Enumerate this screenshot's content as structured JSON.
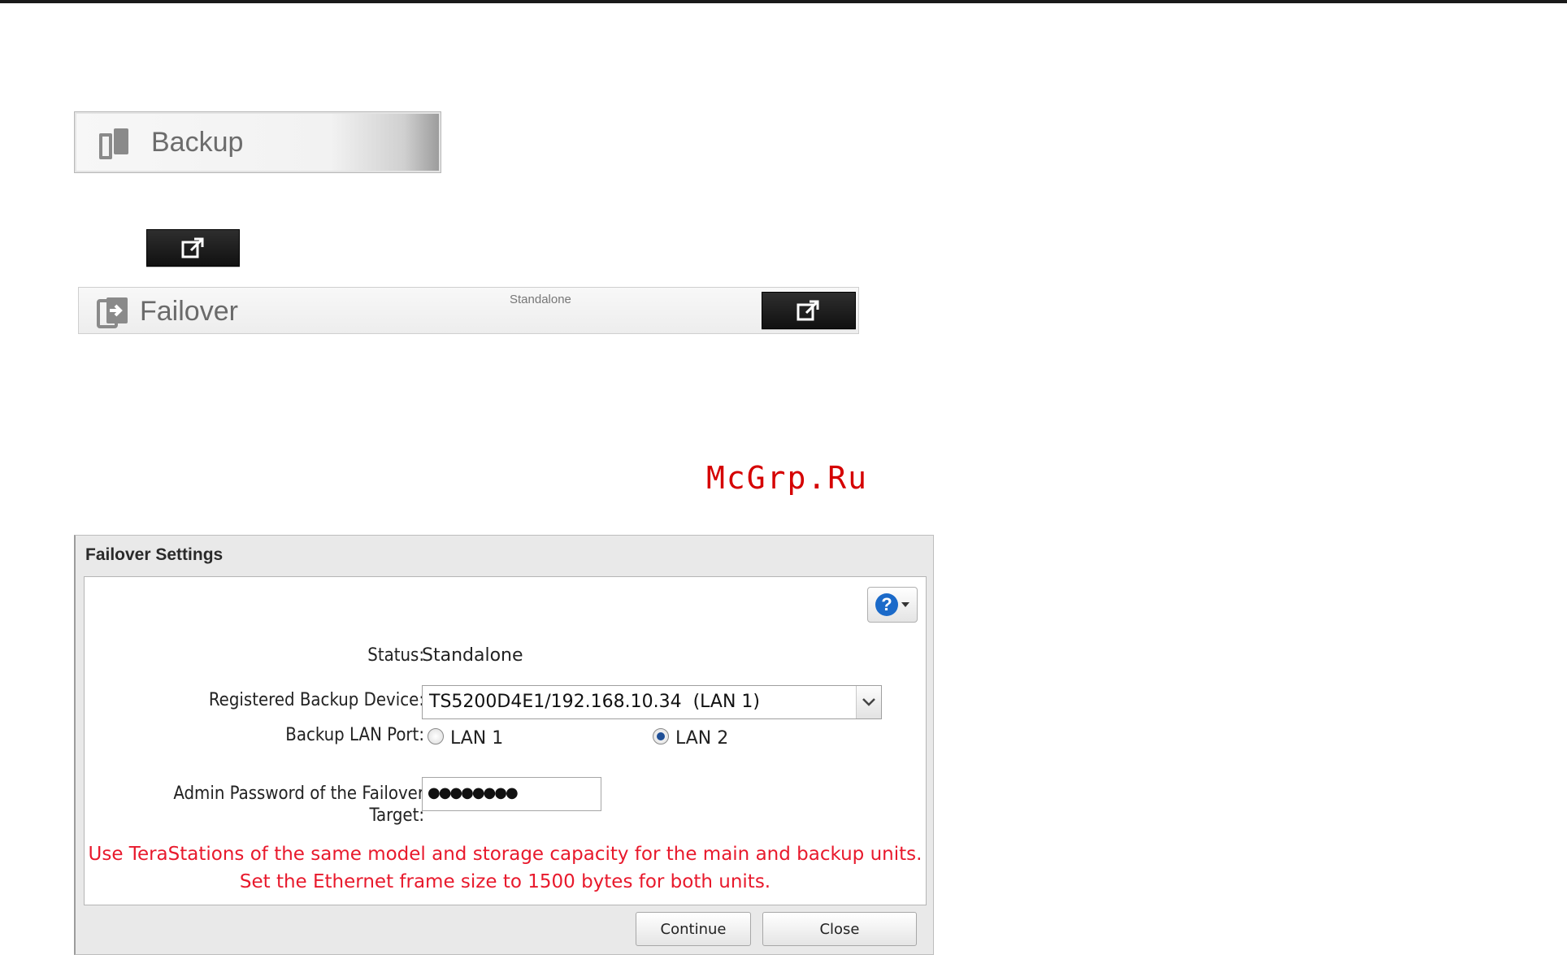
{
  "menu": {
    "backup_label": "Backup",
    "failover_label": "Failover",
    "failover_status": "Standalone"
  },
  "watermark": "McGrp.Ru",
  "dialog": {
    "title": "Failover Settings",
    "help_icon": "question-icon",
    "status_label": "Status:",
    "status_value": "Standalone",
    "device_label": "Registered Backup Device:",
    "device_value": "TS5200D4E1/192.168.10.34  (LAN 1)",
    "lan_label": "Backup LAN Port:",
    "lan_options": [
      "LAN 1",
      "LAN 2"
    ],
    "lan_selected": "LAN 2",
    "password_label_1": "Admin Password of the Failover",
    "password_label_2": "Target:",
    "password_value": "●●●●●●●●",
    "warning_1": "Use TeraStations of the same model and storage capacity for the main and backup units.",
    "warning_2": "Set the Ethernet frame size to 1500 bytes for both units.",
    "continue_label": "Continue",
    "close_label": "Close"
  },
  "colors": {
    "warning": "#e8192c",
    "watermark": "#d50000",
    "help": "#1b6ac9"
  }
}
